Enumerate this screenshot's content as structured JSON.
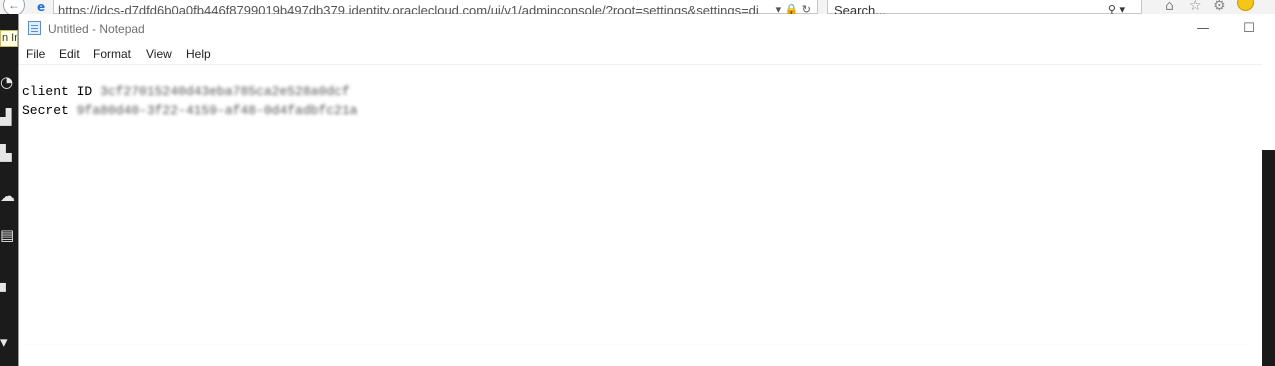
{
  "browser": {
    "url": "https://idcs-d7dfd6b0a0fb446f8799019b497db379.identity.oraclecloud.com/ui/v1/adminconsole/?root=settings&settings=directory",
    "url_controls": "▾ 🔒 ↻",
    "search_placeholder": "Search...",
    "search_icon": "⚲ ▾",
    "tooltip_fragment": "n In"
  },
  "notepad": {
    "title": "Untitled - Notepad",
    "menu": [
      "File",
      "Edit",
      "Format",
      "View",
      "Help"
    ],
    "lines": [
      {
        "label": "client ID ",
        "value": "3cf27015240d43eba785ca2e528a0dcf"
      },
      {
        "label": "Secret ",
        "value": "9fa80d40-3f22-4159-af48-0d4fadbfc21a"
      }
    ],
    "minimize_glyph": "—",
    "maximize_glyph": "☐"
  },
  "icons": {
    "back": "search-back-icon",
    "ie": "internet-explorer-icon",
    "notepad": "notepad-icon"
  },
  "colors": {
    "taskbar": "#1b1b1b",
    "tooltip": "#ffffe1",
    "ie_blue": "#1e73d2",
    "smiley": "#f5c518"
  }
}
